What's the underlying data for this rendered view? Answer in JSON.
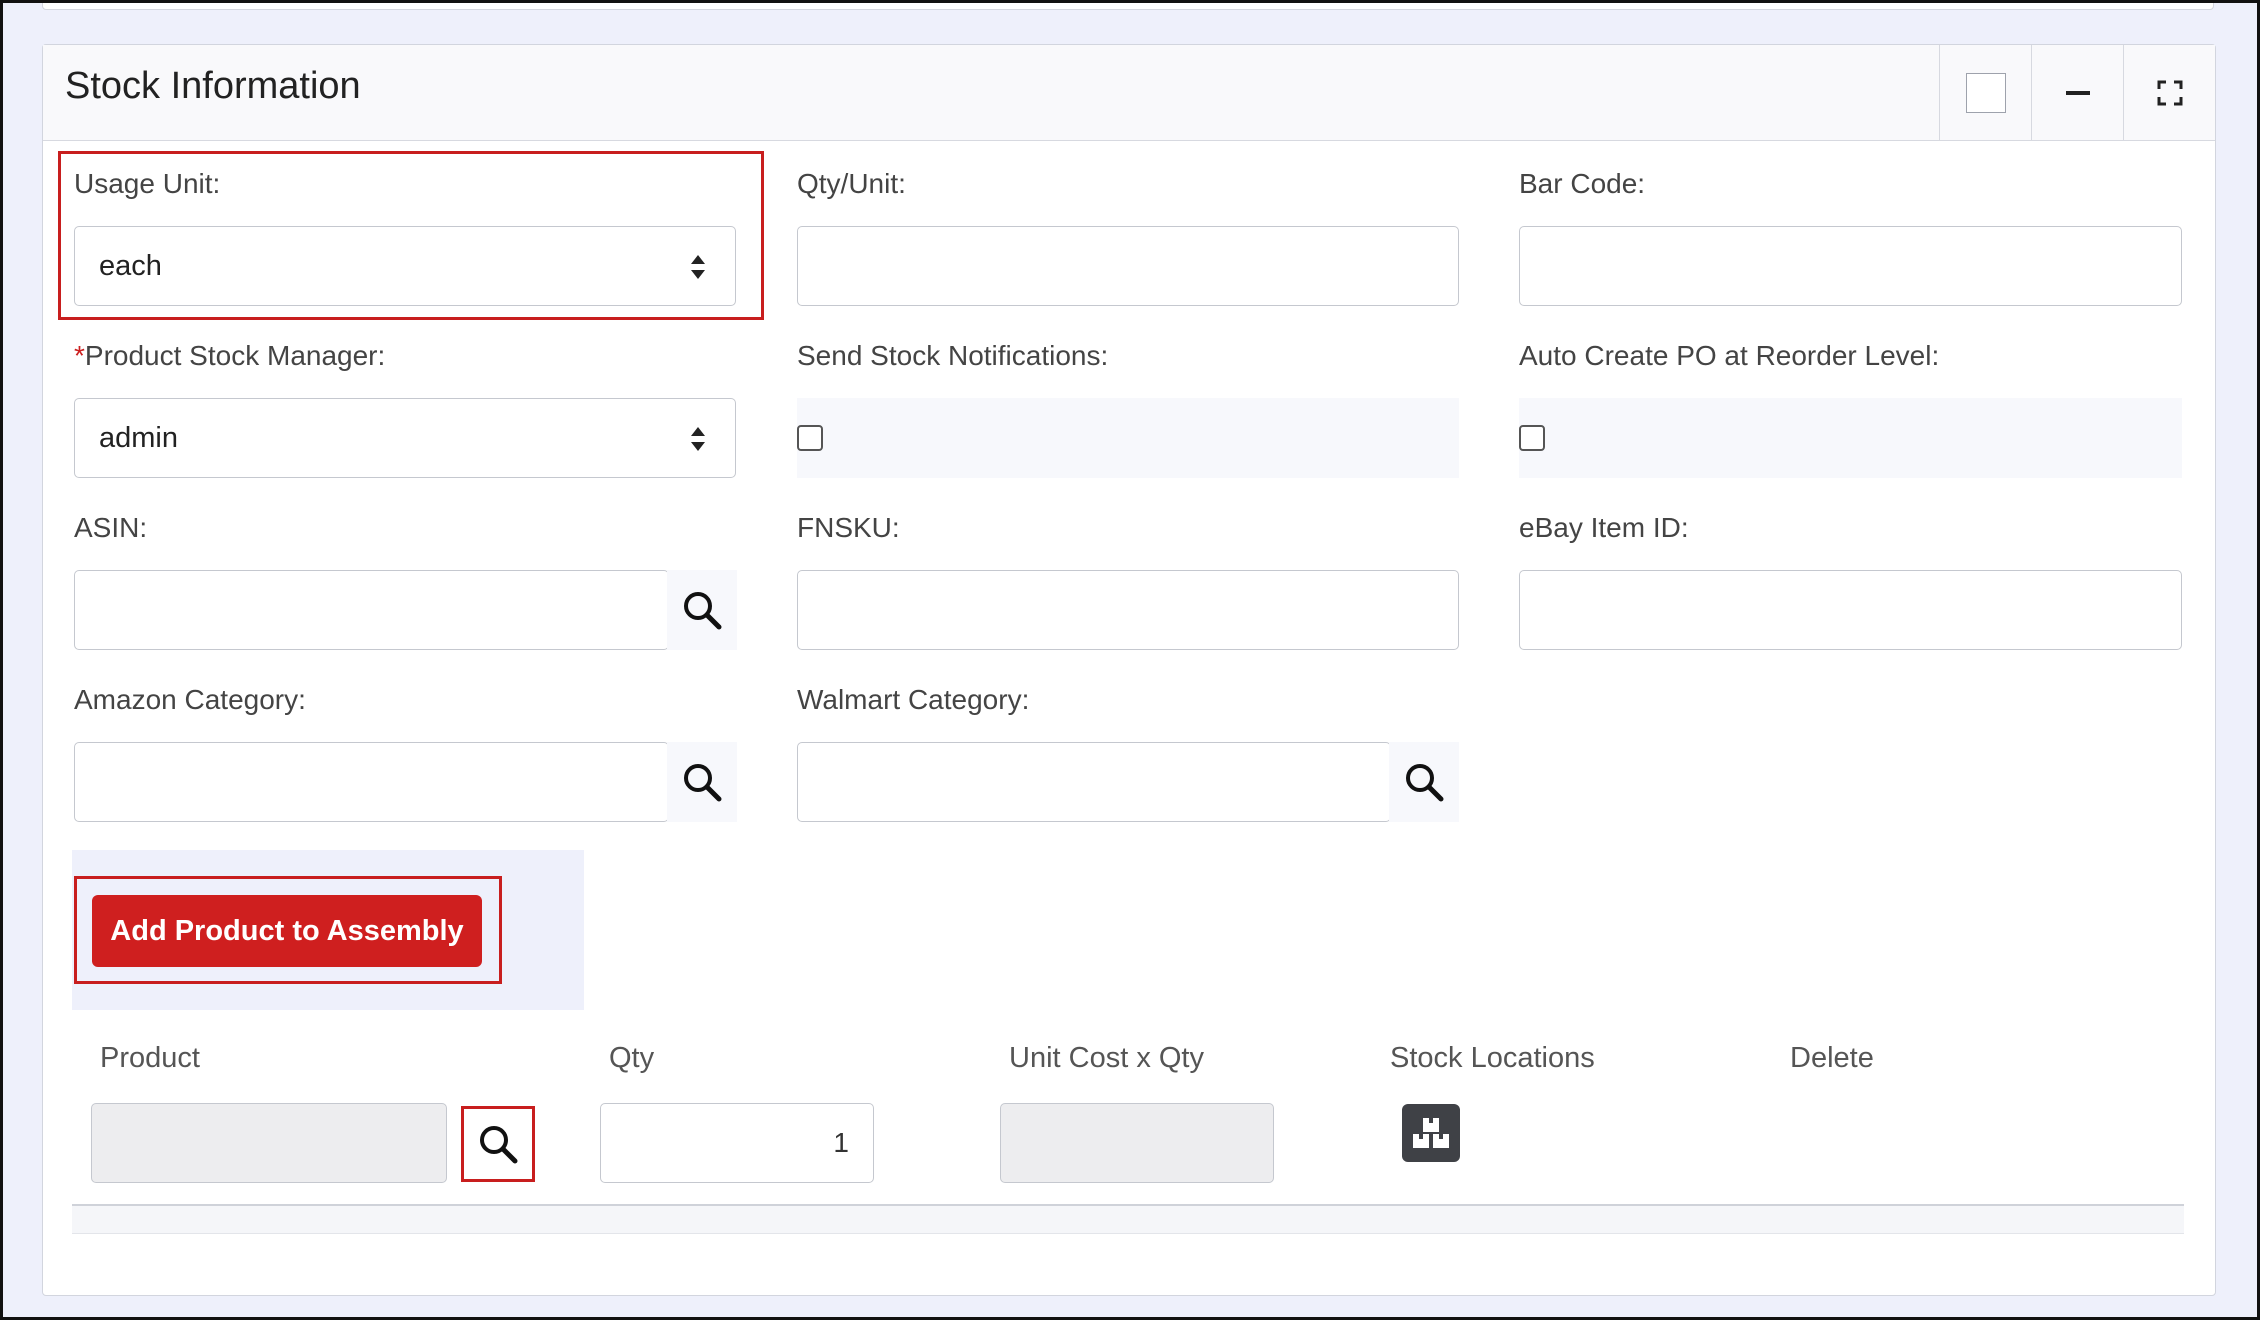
{
  "panel": {
    "title": "Stock Information"
  },
  "fields": {
    "usage_unit": {
      "label": "Usage Unit:",
      "value": "each"
    },
    "qty_unit": {
      "label": "Qty/Unit:",
      "value": ""
    },
    "bar_code": {
      "label": "Bar Code:",
      "value": ""
    },
    "product_stock_manager": {
      "required_mark": "*",
      "label": "Product Stock Manager:",
      "value": "admin"
    },
    "send_stock_notifications": {
      "label": "Send Stock Notifications:",
      "checked": false
    },
    "auto_create_po": {
      "label": "Auto Create PO at Reorder Level:",
      "checked": false
    },
    "asin": {
      "label": "ASIN:",
      "value": ""
    },
    "fnsku": {
      "label": "FNSKU:",
      "value": ""
    },
    "ebay_item_id": {
      "label": "eBay Item ID:",
      "value": ""
    },
    "amazon_category": {
      "label": "Amazon Category:",
      "value": ""
    },
    "walmart_category": {
      "label": "Walmart Category:",
      "value": ""
    }
  },
  "assembly": {
    "add_button_label": "Add Product to Assembly",
    "columns": [
      "Product",
      "Qty",
      "Unit Cost x Qty",
      "Stock Locations",
      "Delete"
    ],
    "row": {
      "product": "",
      "qty": "1",
      "unit_cost_x_qty": ""
    }
  },
  "icons": {
    "header": [
      "square-icon",
      "minimize-icon",
      "fullscreen-icon"
    ],
    "search": "search-icon",
    "stock_locations": "boxes-icon"
  },
  "colors": {
    "accent_red": "#cf1f1f",
    "highlight_red": "#c81e1e",
    "page_bg": "#eef0fb"
  }
}
